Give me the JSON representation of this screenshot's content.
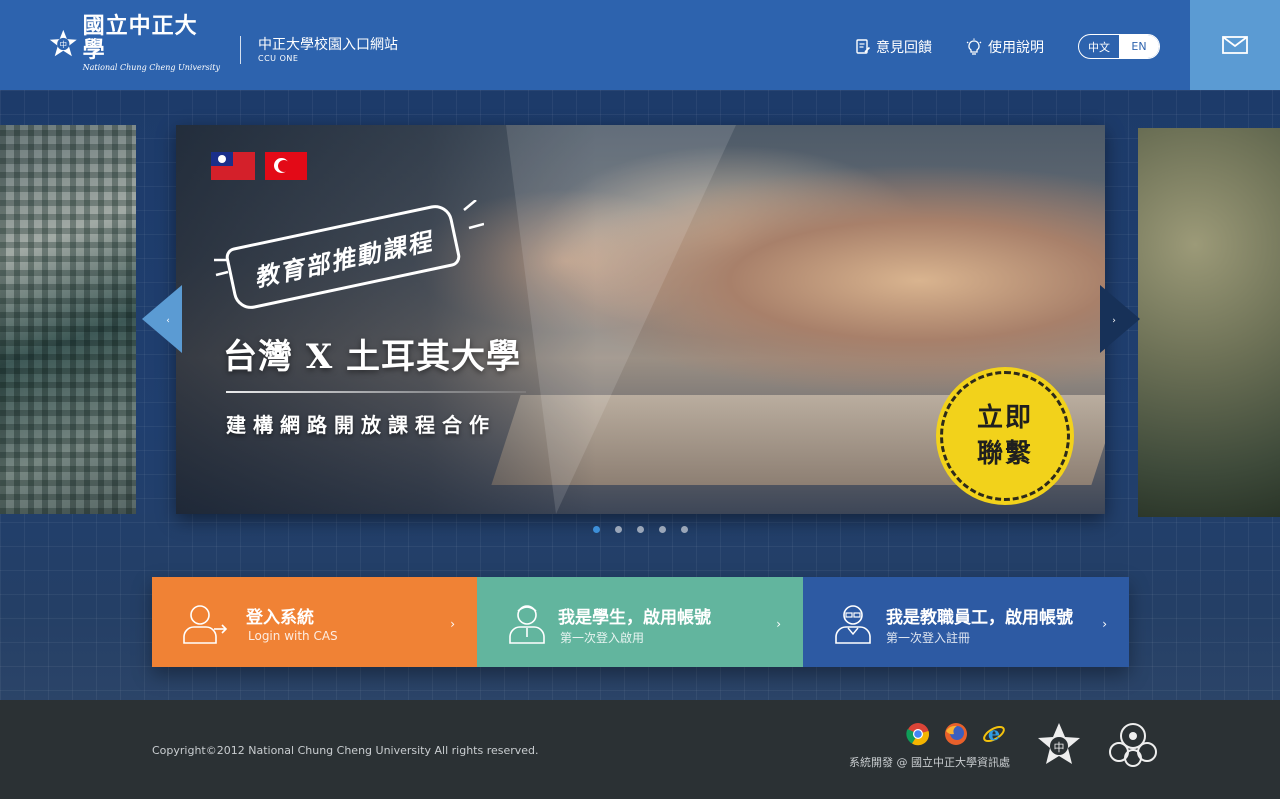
{
  "header": {
    "logo_cn": "國立中正大學",
    "logo_en": "National Chung Cheng University",
    "portal_title": "中正大學校園入口網站",
    "portal_subtitle": "CCU ONE",
    "links": {
      "feedback": "意見回饋",
      "help": "使用說明"
    },
    "lang": {
      "zh": "中文",
      "en": "EN"
    }
  },
  "carousel": {
    "banner_ribbon": "教育部推動課程",
    "headline": "台灣 X 土耳其大學",
    "subline": "建構網路開放課程合作",
    "cta_line1": "立即",
    "cta_line2": "聯繫",
    "slide_count": 5,
    "active_index": 0
  },
  "actions": {
    "login": {
      "title": "登入系統",
      "subtitle": "Login with CAS"
    },
    "student": {
      "title": "我是學生，啟用帳號",
      "subtitle": "第一次登入啟用"
    },
    "staff": {
      "title": "我是教職員工，啟用帳號",
      "subtitle": "第一次登入註冊"
    }
  },
  "footer": {
    "copyright": "Copyright©2012 National Chung Cheng University All rights reserved.",
    "developer": "系統開發 @ 國立中正大學資訊處",
    "browser_icons": [
      "chrome-icon",
      "firefox-icon",
      "ie-icon"
    ]
  },
  "colors": {
    "header_bg": "#2d63ae",
    "mail_bg": "#5b9bd3",
    "login_bg": "#f08235",
    "student_bg": "#62b59e",
    "staff_bg": "#2d5aa3",
    "footer_bg": "#2b3134",
    "active_dot": "#3d8fd8"
  }
}
